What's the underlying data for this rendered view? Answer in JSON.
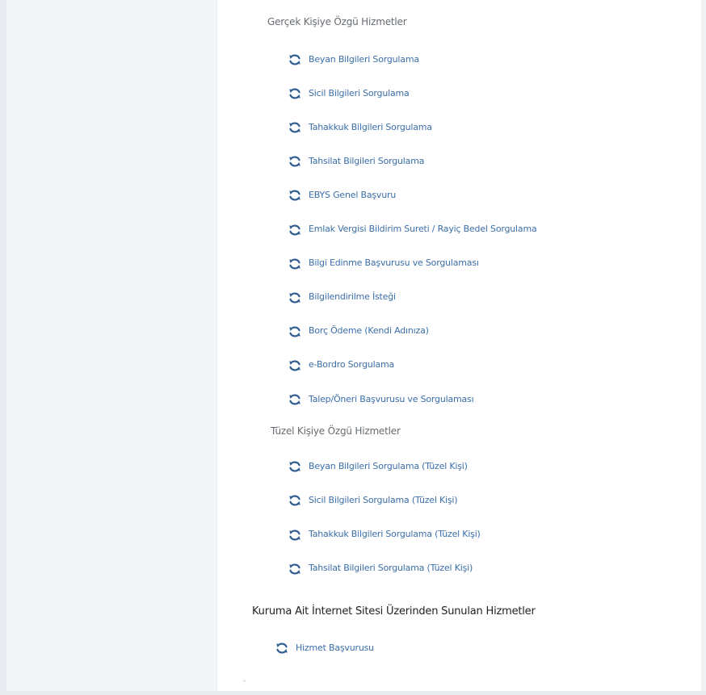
{
  "sections": {
    "gercek_heading": "Gerçek Kişiye Özgü Hizmetler",
    "gercek_items": [
      "Beyan Bilgileri Sorgulama",
      "Sicil Bilgileri Sorgulama",
      "Tahakkuk Bilgileri Sorgulama",
      "Tahsilat Bilgileri Sorgulama",
      "EBYS Genel Başvuru",
      "Emlak Vergisi Bildirim Sureti / Rayiç Bedel Sorgulama",
      "Bilgi Edinme Başvurusu ve Sorgulaması",
      "Bilgilendirilme İsteği",
      "Borç Ödeme (Kendi Adınıza)",
      "e-Bordro Sorgulama",
      "Talep/Öneri Başvurusu ve Sorgulaması"
    ],
    "tuzel_heading": "Tüzel Kişiye Özgü Hizmetler",
    "tuzel_items": [
      "Beyan Bilgileri Sorgulama (Tüzel Kişi)",
      "Sicil Bilgileri Sorgulama (Tüzel Kişi)",
      "Tahakkuk Bilgileri Sorgulama (Tüzel Kişi)",
      "Tahsilat Bilgileri Sorgulama (Tüzel Kişi)"
    ],
    "kurum_heading": "Kuruma Ait İnternet Sitesi Üzerinden Sunulan Hizmetler",
    "kurum_items": [
      "Hizmet Başvurusu"
    ]
  },
  "colors": {
    "link": "#3a6ea8",
    "icon": "#2f5d91",
    "heading": "#666b70",
    "bold_heading": "#222222",
    "sidebar": "#f3f6f8"
  },
  "icons": {
    "service": "refresh-icon"
  }
}
